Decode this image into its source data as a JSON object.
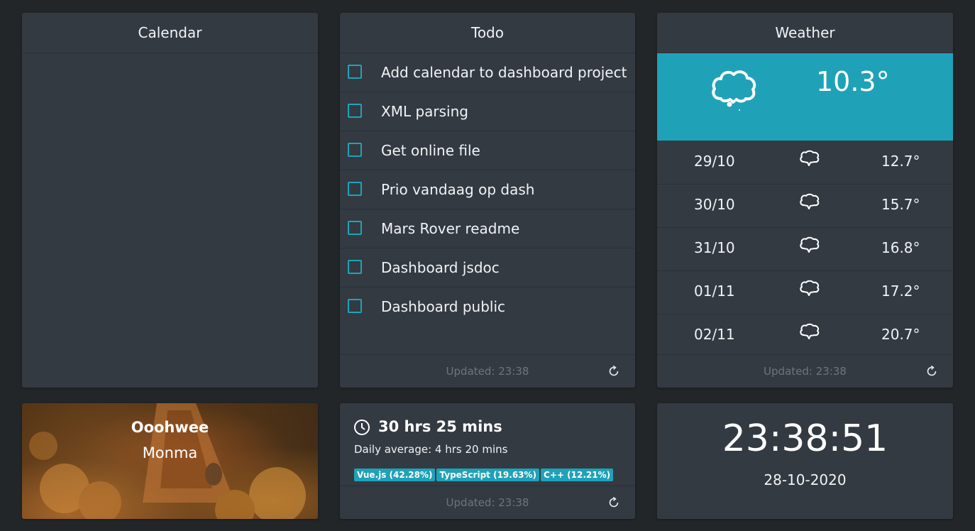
{
  "calendar": {
    "title": "Calendar"
  },
  "todo": {
    "title": "Todo",
    "items": [
      {
        "label": "Add calendar to dashboard project",
        "checked": false
      },
      {
        "label": "XML parsing",
        "checked": false
      },
      {
        "label": "Get online file",
        "checked": false
      },
      {
        "label": "Prio vandaag op dash",
        "checked": false
      },
      {
        "label": "Mars Rover readme",
        "checked": false
      },
      {
        "label": "Dashboard jsdoc",
        "checked": false
      },
      {
        "label": "Dashboard public",
        "checked": false
      }
    ],
    "updated": "Updated: 23:38",
    "icon": "refresh-icon"
  },
  "weather": {
    "title": "Weather",
    "current": {
      "temp": "10.3°",
      "icon": "cloud-icon"
    },
    "forecast": [
      {
        "date": "29/10",
        "temp": "12.7°",
        "icon": "cloud-icon"
      },
      {
        "date": "30/10",
        "temp": "15.7°",
        "icon": "cloud-icon"
      },
      {
        "date": "31/10",
        "temp": "16.8°",
        "icon": "cloud-icon"
      },
      {
        "date": "01/11",
        "temp": "17.2°",
        "icon": "cloud-icon"
      },
      {
        "date": "02/11",
        "temp": "20.7°",
        "icon": "cloud-icon"
      }
    ],
    "updated": "Updated: 23:38",
    "icon": "refresh-icon"
  },
  "music": {
    "title": "Ooohwee",
    "artist": "Monma"
  },
  "coding": {
    "total": "30 hrs 25 mins",
    "daily": "Daily average: 4 hrs 20 mins",
    "languages": [
      "Vue.js (42.28%)",
      "TypeScript (19.63%)",
      "C++ (12.21%)"
    ],
    "updated": "Updated: 23:38",
    "icon": "clock-icon"
  },
  "clock": {
    "time": "23:38:51",
    "date": "28-10-2020"
  },
  "colors": {
    "accent": "#1fa2b8",
    "card": "#343a42",
    "background": "#232629"
  }
}
